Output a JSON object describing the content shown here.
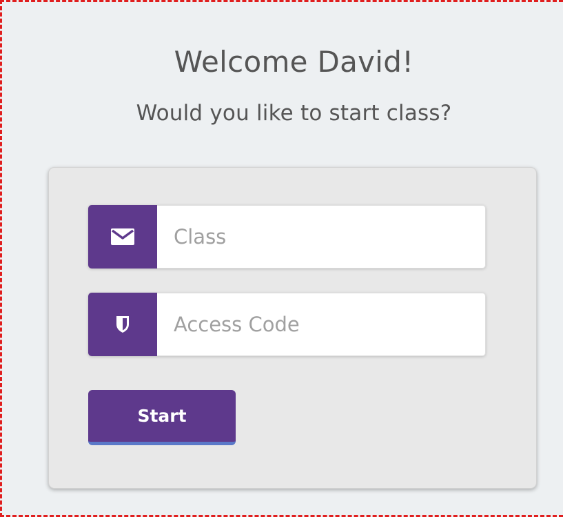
{
  "header": {
    "title": "Welcome David!",
    "subtitle": "Would you like to start class?"
  },
  "form": {
    "class_field": {
      "placeholder": "Class",
      "value": "",
      "icon": "envelope-icon"
    },
    "access_code_field": {
      "placeholder": "Access Code",
      "value": "",
      "icon": "shield-icon"
    },
    "start_button_label": "Start"
  },
  "colors": {
    "accent": "#5e398c",
    "button_underline": "#5a78c8",
    "page_background": "#edf0f2",
    "card_background": "#e8e8e8",
    "frame_border": "#e01e1e"
  }
}
